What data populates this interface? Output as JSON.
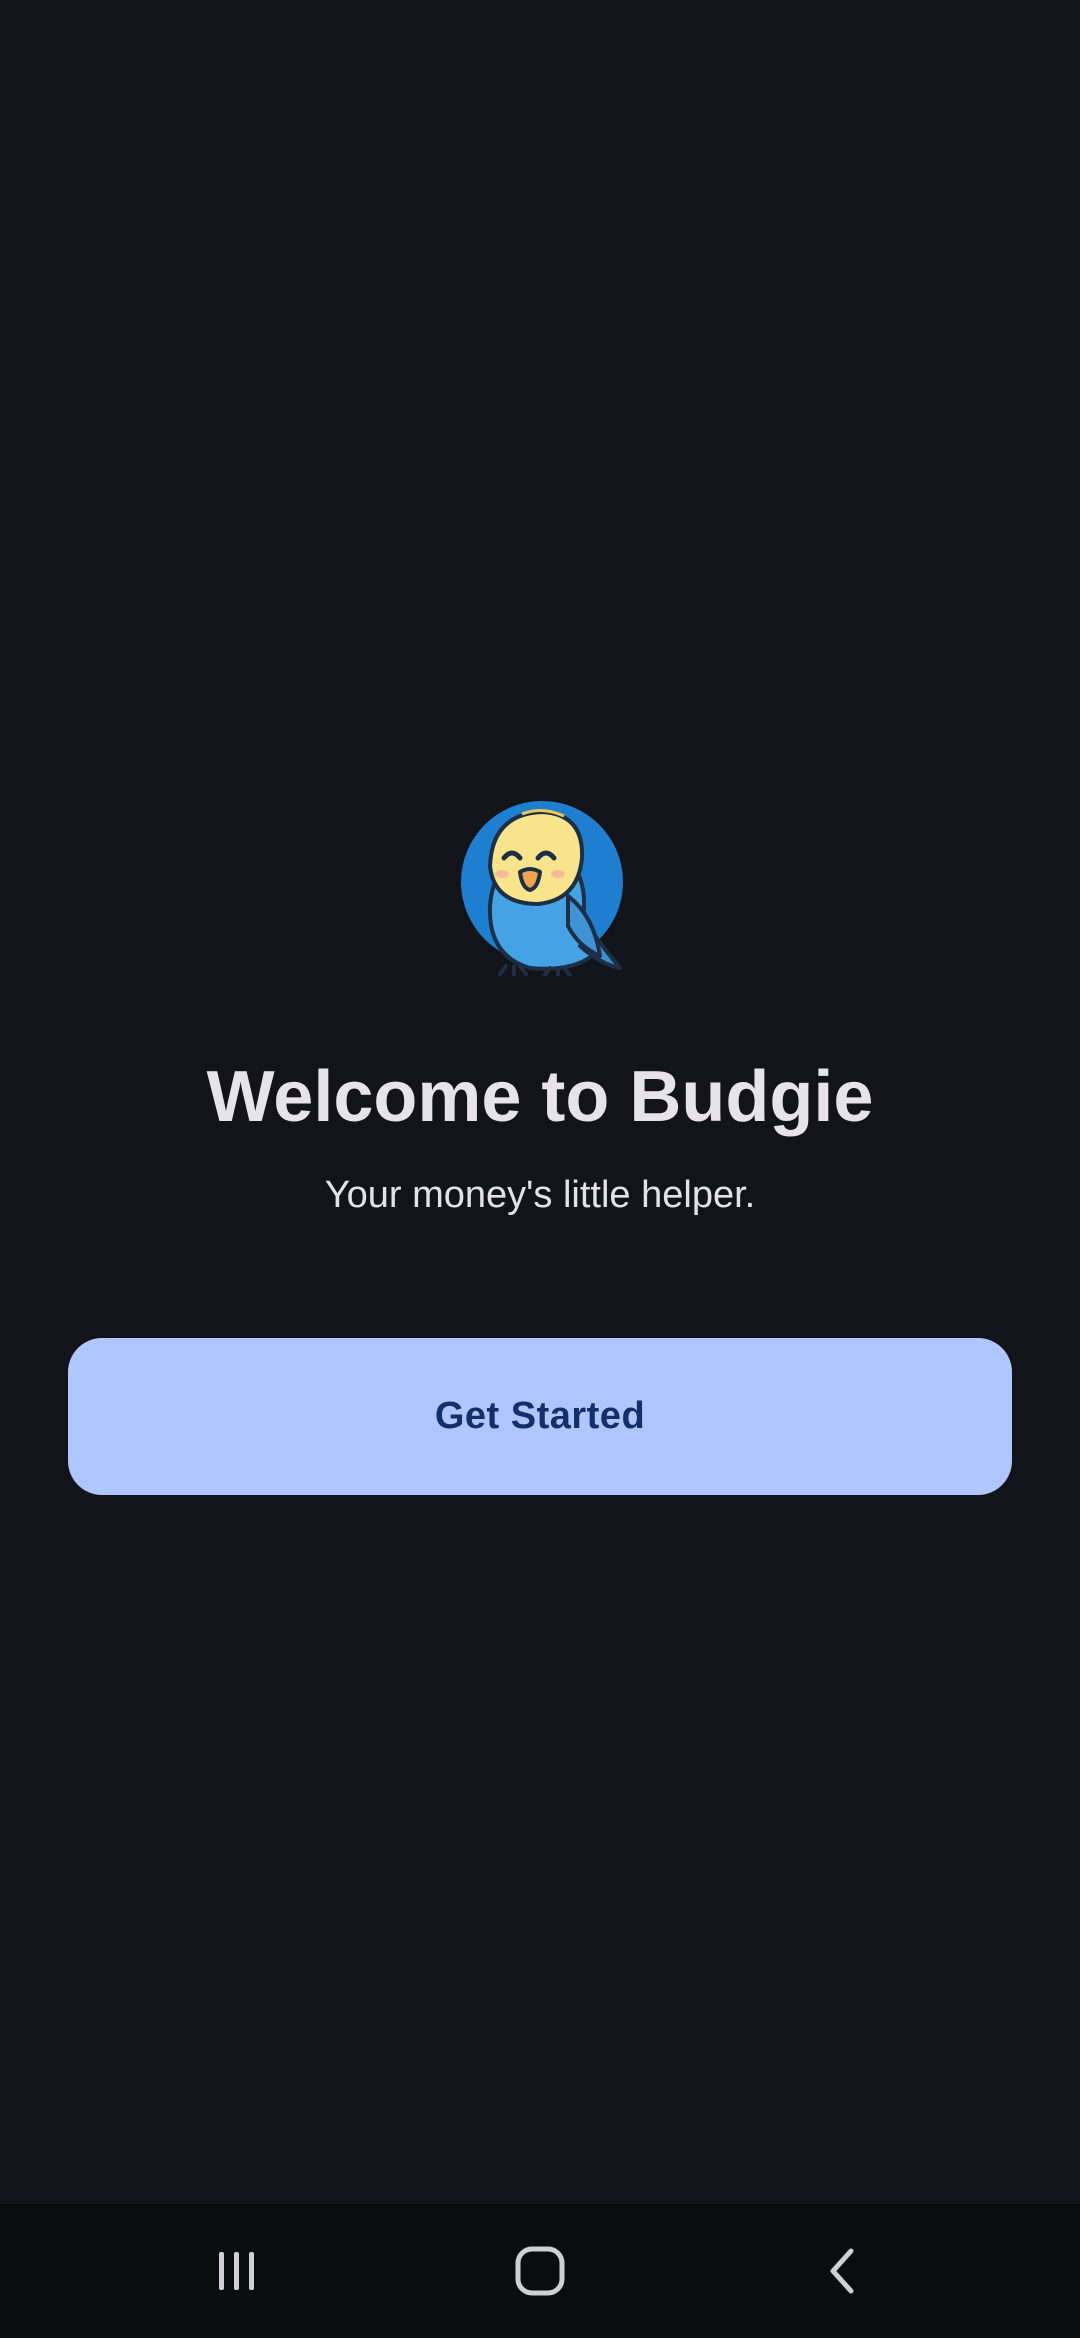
{
  "welcome": {
    "title": "Welcome to Budgie",
    "subtitle": "Your money's little helper.",
    "cta_label": "Get Started",
    "logo_icon": "budgie-bird-icon"
  },
  "nav_bar": {
    "buttons": [
      "recent-apps-icon",
      "home-icon",
      "back-icon"
    ]
  },
  "colors": {
    "background": "#131419",
    "title_text": "#e6e4ea",
    "button_bg": "#afc6ff",
    "button_text": "#13306a",
    "nav_bg": "#0b0c0e",
    "logo_circle": "#1e7fd0",
    "bird_head": "#f8e48a",
    "bird_body": "#45a3e5"
  }
}
